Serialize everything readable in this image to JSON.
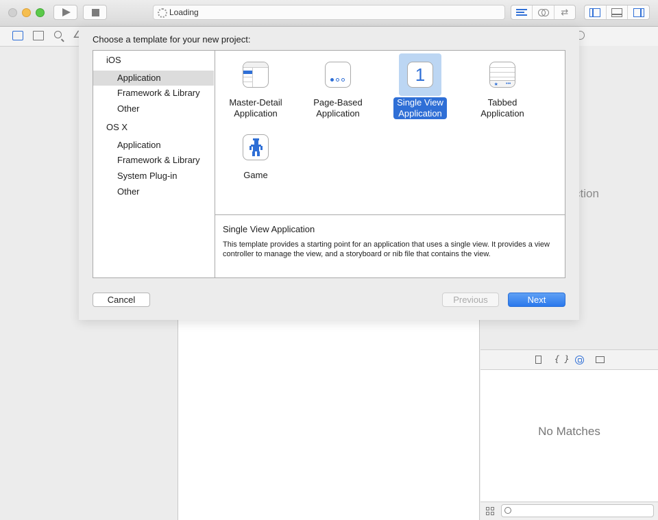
{
  "toolbar": {
    "activity_status": "Loading",
    "play_button": "play-icon",
    "stop_button": "stop-icon",
    "editor_modes": [
      "standard-editor-icon",
      "assistant-editor-icon",
      "version-editor-icon"
    ],
    "view_toggles": [
      "navigator-toggle-icon",
      "debug-area-toggle-icon",
      "utilities-toggle-icon"
    ]
  },
  "navigator": {
    "icons": [
      "project-navigator-icon",
      "symbol-navigator-icon",
      "find-navigator-icon",
      "issue-navigator-icon"
    ]
  },
  "sheet": {
    "title": "Choose a template for your new project:",
    "sidebar": [
      {
        "label": "iOS",
        "kind": "category"
      },
      {
        "label": "Application",
        "kind": "item",
        "selected": true
      },
      {
        "label": "Framework & Library",
        "kind": "item"
      },
      {
        "label": "Other",
        "kind": "item"
      },
      {
        "label": "OS X",
        "kind": "category"
      },
      {
        "label": "Application",
        "kind": "item"
      },
      {
        "label": "Framework & Library",
        "kind": "item"
      },
      {
        "label": "System Plug-in",
        "kind": "item"
      },
      {
        "label": "Other",
        "kind": "item"
      }
    ],
    "templates": [
      {
        "line1": "Master-Detail",
        "line2": "Application",
        "icon": "master-detail-icon"
      },
      {
        "line1": "Page-Based",
        "line2": "Application",
        "icon": "page-based-icon"
      },
      {
        "line1": "Single View",
        "line2": "Application",
        "icon": "single-view-icon",
        "selected": true,
        "icon_text": "1"
      },
      {
        "line1": "Tabbed",
        "line2": "Application",
        "icon": "tabbed-icon"
      },
      {
        "line1": "Game",
        "line2": "",
        "icon": "game-icon"
      }
    ],
    "description": {
      "title": "Single View Application",
      "text": "This template provides a starting point for an application that uses a single view. It provides a view controller to manage the view, and a storyboard or nib file that contains the view."
    },
    "buttons": {
      "cancel": "Cancel",
      "previous": "Previous",
      "next": "Next"
    }
  },
  "utilities": {
    "partial_text": "ction",
    "library_tabs": [
      "file-template-icon",
      "code-snippet-icon",
      "object-library-icon",
      "media-library-icon"
    ],
    "empty_message": "No Matches",
    "filter_placeholder": ""
  },
  "colors": {
    "accent": "#2f6fd6",
    "selection_bg": "#bcd6f3",
    "sidebar_selection": "#dcdcdc"
  }
}
